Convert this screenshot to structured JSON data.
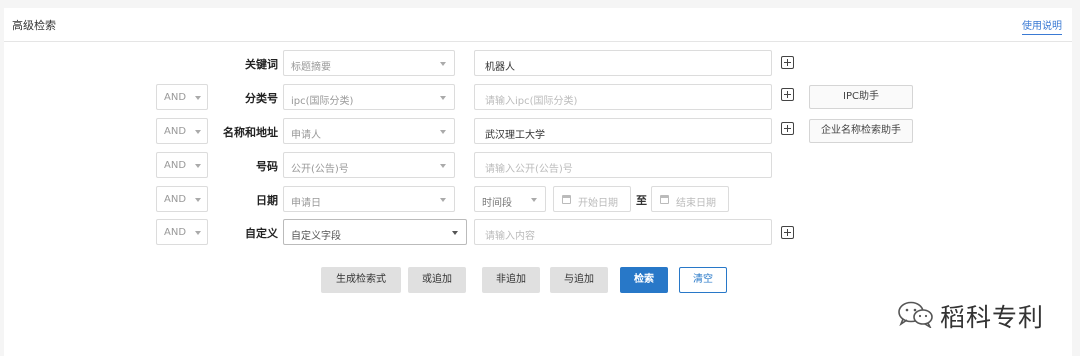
{
  "panel": {
    "title": "高级检索",
    "help_link": "使用说明"
  },
  "rows": [
    {
      "label": "关键词",
      "field": "标题摘要",
      "value": "机器人",
      "has_plus": true
    },
    {
      "logic": "AND",
      "label": "分类号",
      "field": "ipc(国际分类)",
      "placeholder": "请输入ipc(国际分类)",
      "has_plus": true,
      "side_button": "IPC助手"
    },
    {
      "logic": "AND",
      "label": "名称和地址",
      "field": "申请人",
      "value": "武汉理工大学",
      "has_plus": true,
      "side_button": "企业名称检索助手"
    },
    {
      "logic": "AND",
      "label": "号码",
      "field": "公开(公告)号",
      "placeholder": "请输入公开(公告)号"
    },
    {
      "logic": "AND",
      "label": "日期",
      "field": "申请日",
      "range": "时间段",
      "start_placeholder": "开始日期",
      "to": "至",
      "end_placeholder": "结束日期"
    },
    {
      "logic": "AND",
      "label": "自定义",
      "field": "自定义字段",
      "placeholder": "请输入内容",
      "has_plus": true
    }
  ],
  "actions": {
    "generate": "生成检索式",
    "or_add": "或追加",
    "not_add": "非追加",
    "and_add": "与追加",
    "search": "检索",
    "clear": "清空"
  },
  "watermark": {
    "text": "稻科专利"
  }
}
